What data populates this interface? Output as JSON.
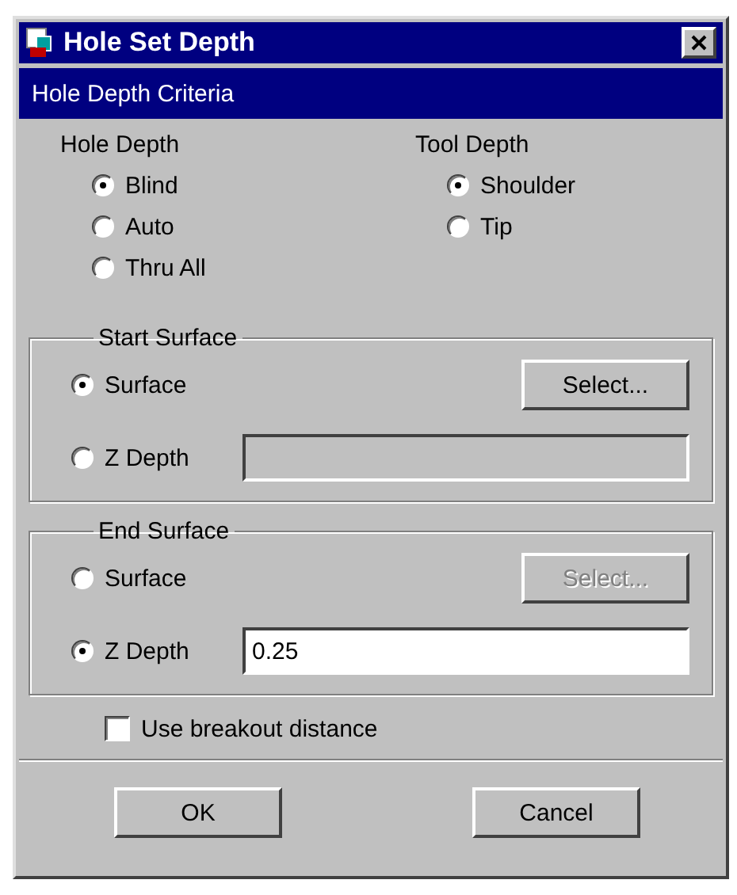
{
  "window": {
    "title": "Hole Set Depth"
  },
  "header": "Hole Depth Criteria",
  "option_columns": [
    {
      "label": "Hole Depth",
      "options": [
        {
          "label": "Blind",
          "selected": true
        },
        {
          "label": "Auto",
          "selected": false
        },
        {
          "label": "Thru All",
          "selected": false
        }
      ]
    },
    {
      "label": "Tool Depth",
      "options": [
        {
          "label": "Shoulder",
          "selected": true
        },
        {
          "label": "Tip",
          "selected": false
        }
      ]
    }
  ],
  "surface_groups": [
    {
      "title": "Start Surface",
      "surface": {
        "label": "Surface",
        "selected": true
      },
      "select_button": {
        "label": "Select...",
        "disabled": false
      },
      "z_depth": {
        "label": "Z Depth",
        "selected": false
      }
    },
    {
      "title": "End Surface",
      "surface": {
        "label": "Surface",
        "selected": false
      },
      "select_button": {
        "label": "Select...",
        "disabled": true
      },
      "z_depth": {
        "label": "Z Depth",
        "selected": true,
        "value": "0.25"
      }
    }
  ],
  "breakout": {
    "label": "Use breakout distance",
    "checked": false
  },
  "buttons": [
    "OK",
    "Cancel"
  ]
}
